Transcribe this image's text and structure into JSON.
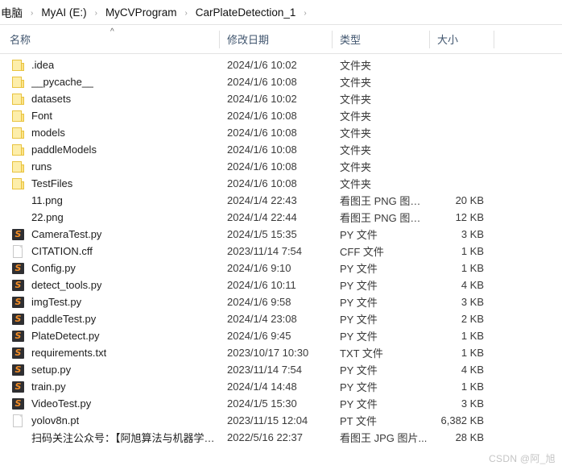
{
  "breadcrumb": {
    "separator": "›",
    "items": [
      {
        "label": "电脑"
      },
      {
        "label": "MyAI (E:)"
      },
      {
        "label": "MyCVProgram"
      },
      {
        "label": "CarPlateDetection_1"
      }
    ]
  },
  "columns": {
    "name": "名称",
    "date_modified": "修改日期",
    "type": "类型",
    "size": "大小",
    "sort_caret": "^"
  },
  "files": [
    {
      "name": ".idea",
      "icon": "folder",
      "date": "2024/1/6 10:02",
      "type": "文件夹",
      "size": ""
    },
    {
      "name": "__pycache__",
      "icon": "folder",
      "date": "2024/1/6 10:08",
      "type": "文件夹",
      "size": ""
    },
    {
      "name": "datasets",
      "icon": "folder",
      "date": "2024/1/6 10:02",
      "type": "文件夹",
      "size": ""
    },
    {
      "name": "Font",
      "icon": "folder",
      "date": "2024/1/6 10:08",
      "type": "文件夹",
      "size": ""
    },
    {
      "name": "models",
      "icon": "folder",
      "date": "2024/1/6 10:08",
      "type": "文件夹",
      "size": ""
    },
    {
      "name": "paddleModels",
      "icon": "folder",
      "date": "2024/1/6 10:08",
      "type": "文件夹",
      "size": ""
    },
    {
      "name": "runs",
      "icon": "folder",
      "date": "2024/1/6 10:08",
      "type": "文件夹",
      "size": ""
    },
    {
      "name": "TestFiles",
      "icon": "folder",
      "date": "2024/1/6 10:08",
      "type": "文件夹",
      "size": ""
    },
    {
      "name": "11.png",
      "icon": "image",
      "date": "2024/1/4 22:43",
      "type": "看图王 PNG 图片...",
      "size": "20 KB"
    },
    {
      "name": "22.png",
      "icon": "image",
      "date": "2024/1/4 22:44",
      "type": "看图王 PNG 图片...",
      "size": "12 KB"
    },
    {
      "name": "CameraTest.py",
      "icon": "sublime",
      "date": "2024/1/5 15:35",
      "type": "PY 文件",
      "size": "3 KB"
    },
    {
      "name": "CITATION.cff",
      "icon": "doc",
      "date": "2023/11/14 7:54",
      "type": "CFF 文件",
      "size": "1 KB"
    },
    {
      "name": "Config.py",
      "icon": "sublime",
      "date": "2024/1/6 9:10",
      "type": "PY 文件",
      "size": "1 KB"
    },
    {
      "name": "detect_tools.py",
      "icon": "sublime",
      "date": "2024/1/6 10:11",
      "type": "PY 文件",
      "size": "4 KB"
    },
    {
      "name": "imgTest.py",
      "icon": "sublime",
      "date": "2024/1/6 9:58",
      "type": "PY 文件",
      "size": "3 KB"
    },
    {
      "name": "paddleTest.py",
      "icon": "sublime",
      "date": "2024/1/4 23:08",
      "type": "PY 文件",
      "size": "2 KB"
    },
    {
      "name": "PlateDetect.py",
      "icon": "sublime",
      "date": "2024/1/6 9:45",
      "type": "PY 文件",
      "size": "1 KB"
    },
    {
      "name": "requirements.txt",
      "icon": "sublime",
      "date": "2023/10/17 10:30",
      "type": "TXT 文件",
      "size": "1 KB"
    },
    {
      "name": "setup.py",
      "icon": "sublime",
      "date": "2023/11/14 7:54",
      "type": "PY 文件",
      "size": "4 KB"
    },
    {
      "name": "train.py",
      "icon": "sublime",
      "date": "2024/1/4 14:48",
      "type": "PY 文件",
      "size": "1 KB"
    },
    {
      "name": "VideoTest.py",
      "icon": "sublime",
      "date": "2024/1/5 15:30",
      "type": "PY 文件",
      "size": "3 KB"
    },
    {
      "name": "yolov8n.pt",
      "icon": "doc",
      "date": "2023/11/15 12:04",
      "type": "PT 文件",
      "size": "6,382 KB"
    },
    {
      "name": "扫码关注公众号：【阿旭算法与机器学习...",
      "icon": "image",
      "date": "2022/5/16 22:37",
      "type": "看图王 JPG 图片...",
      "size": "28 KB"
    }
  ],
  "watermark": {
    "text": "CSDN @阿_旭"
  },
  "colors": {
    "header_text": "#40556e",
    "folder_fill": "#fdeeaa",
    "folder_border": "#e8c33f",
    "sublime_bg": "#2f2f32",
    "sublime_glyph": "#f28d27",
    "divider": "#e3e3e3",
    "watermark": "#c4c4c4"
  }
}
